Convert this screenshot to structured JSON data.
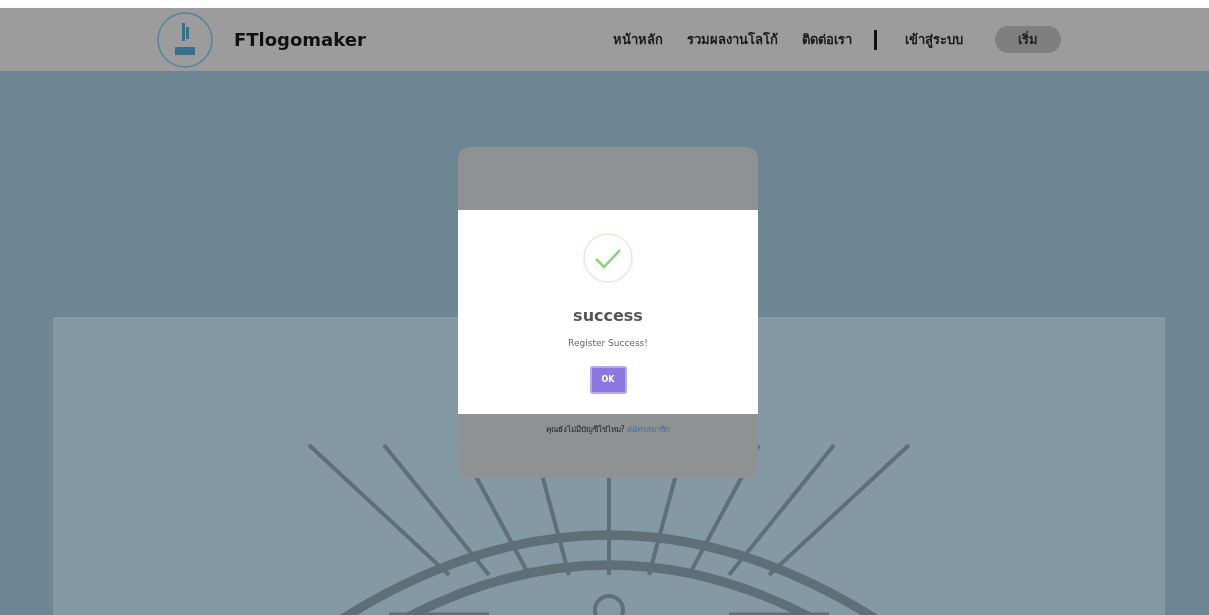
{
  "header": {
    "brand": "FTlogomaker",
    "nav": [
      {
        "label": "หน้าหลัก",
        "kind": "link"
      },
      {
        "label": "รวมผลงานโลโก้",
        "kind": "link"
      },
      {
        "label": "ติดต่อเรา",
        "kind": "link"
      },
      {
        "label": "เข้าสู่ระบบ",
        "kind": "link"
      },
      {
        "label": "เริ่ม",
        "kind": "button"
      }
    ]
  },
  "login_card": {
    "signup_prompt": "คุณยังไม่มีบัญชีใช่ไหม?",
    "signup_link": "สมัครสมาชิก"
  },
  "dialog": {
    "title": "success",
    "message": "Register Success!",
    "button": "OK"
  }
}
